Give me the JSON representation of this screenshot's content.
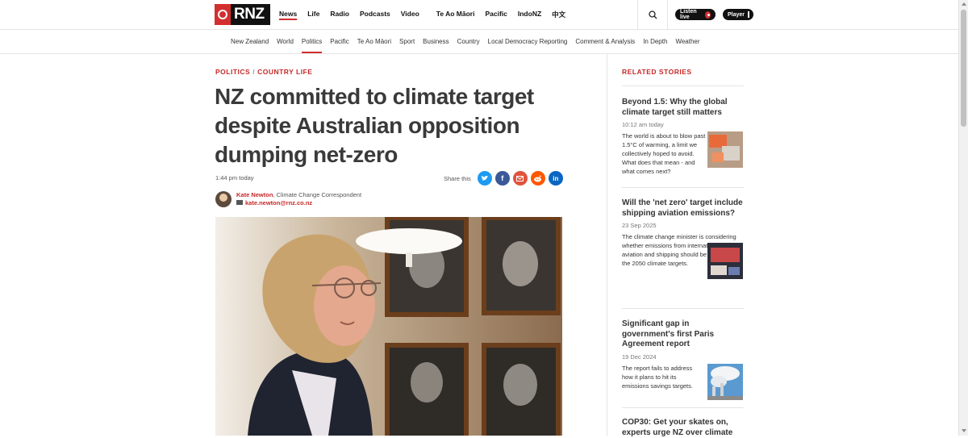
{
  "header": {
    "logo_text": "RNZ",
    "nav": [
      {
        "label": "News",
        "active": true
      },
      {
        "label": "Life"
      },
      {
        "label": "Radio"
      },
      {
        "label": "Podcasts"
      },
      {
        "label": "Video"
      },
      {
        "label": "Te Ao Māori"
      },
      {
        "label": "Pacific"
      },
      {
        "label": "IndoNZ"
      },
      {
        "label": "中文"
      }
    ],
    "listen_live": "Listen live",
    "player": "Player"
  },
  "subnav": [
    "New Zealand",
    "World",
    "Politics",
    "Pacific",
    "Te Ao Māori",
    "Sport",
    "Business",
    "Country",
    "Local Democracy Reporting",
    "Comment & Analysis",
    "In Depth",
    "Weather"
  ],
  "subnav_active": "Politics",
  "article": {
    "kicker_1": "POLITICS",
    "kicker_sep": "/",
    "kicker_2": "COUNTRY LIFE",
    "headline": "NZ committed to climate target despite Australian opposition dumping net-zero",
    "timestamp": "1:44 pm today",
    "share_label": "Share this",
    "author_name": "Kate Newton",
    "author_role": ", Climate Change Correspondent",
    "author_email": "kate.newton@rnz.co.nz"
  },
  "related": {
    "title": "RELATED STORIES",
    "stories": [
      {
        "title": "Beyond 1.5: Why the global climate target still matters",
        "date": "10:12 am today",
        "teaser": "The world is about to blow past 1.5°C of warming, a limit we collectively hoped to avoid. What does that mean - and what comes next?"
      },
      {
        "title": "Will the 'net zero' target include shipping aviation emissions?",
        "date": "23 Sep 2025",
        "teaser": "The climate change minister is considering whether emissions from international aviation and shipping should be included in the 2050 climate targets."
      },
      {
        "title": "Significant gap in government's first Paris Agreement report",
        "date": "19 Dec 2024",
        "teaser": "The report fails to address how it plans to hit its emissions savings targets."
      },
      {
        "title": "COP30: Get your skates on, experts urge NZ over climate"
      }
    ]
  },
  "colors": {
    "accent": "#c62828",
    "twitter": "#1d9bf0",
    "facebook": "#3b5998",
    "email": "#e0533d",
    "reddit": "#ff5700",
    "linkedin": "#0a66c2"
  }
}
